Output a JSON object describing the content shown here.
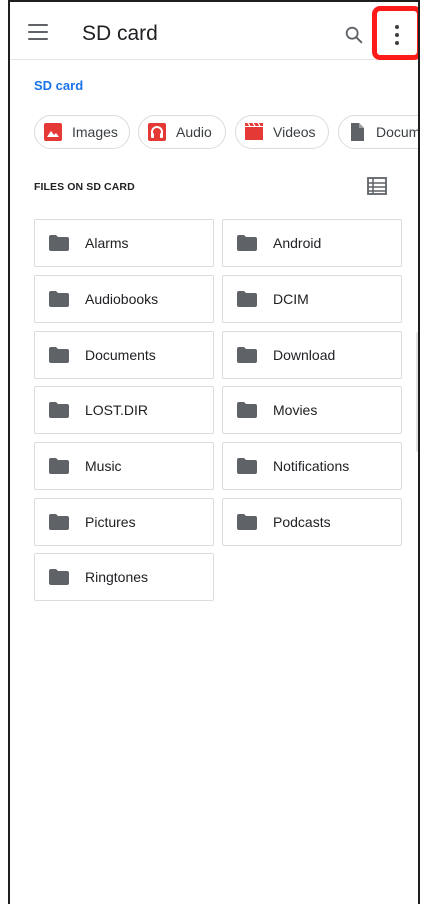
{
  "appbar": {
    "title": "SD card"
  },
  "breadcrumb": "SD card",
  "chips": [
    {
      "label": "Images",
      "icon": "image-icon",
      "color": "#e53935"
    },
    {
      "label": "Audio",
      "icon": "headphones-icon",
      "color": "#e53935"
    },
    {
      "label": "Videos",
      "icon": "film-icon",
      "color": "#e53935"
    },
    {
      "label": "Documents",
      "icon": "document-icon",
      "color": "#5f6368"
    }
  ],
  "section": {
    "label": "FILES ON SD CARD"
  },
  "folders": [
    "Alarms",
    "Android",
    "Audiobooks",
    "DCIM",
    "Documents",
    "Download",
    "LOST.DIR",
    "Movies",
    "Music",
    "Notifications",
    "Pictures",
    "Podcasts",
    "Ringtones"
  ],
  "colors": {
    "accent": "#1a73e8",
    "highlight": "#ff1a1a",
    "folder": "#5f6368"
  }
}
